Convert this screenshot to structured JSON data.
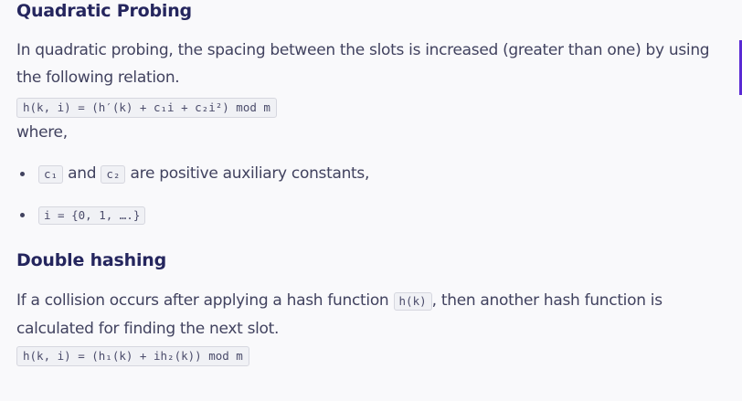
{
  "quadratic": {
    "heading": "Quadratic Probing",
    "intro": "In quadratic probing, the spacing between the slots is increased (greater than one) by using the following relation.",
    "formula": "h(k, i) = (h′(k) + c₁i + c₂i²) mod m",
    "where": "where,",
    "bullet1": {
      "c1": "c₁",
      "and": "and",
      "c2": "c₂",
      "rest": "are positive auxiliary constants,"
    },
    "bullet2": {
      "code": "i = {0, 1, ….}"
    }
  },
  "double": {
    "heading": "Double hashing",
    "text_before": "If a collision occurs after applying a hash function",
    "code": "h(k)",
    "text_after": ", then another hash function is calculated for finding the next slot.",
    "formula": "h(k, i) = (h₁(k) + ih₂(k)) mod m"
  },
  "colors": {
    "heading": "#25265e",
    "body_text": "#41425f",
    "code_bg": "#f0f1f5",
    "code_border": "#d6d7df",
    "accent": "#5a2ad4"
  }
}
